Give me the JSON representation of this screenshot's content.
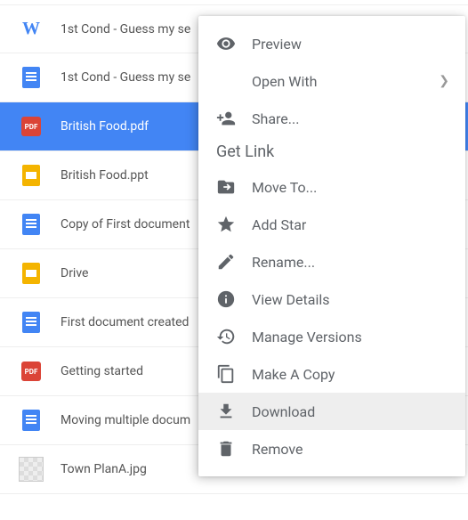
{
  "files": [
    {
      "name": "1st Cond - Guess my se",
      "icon": "word",
      "selected": false
    },
    {
      "name": "1st Cond - Guess my se",
      "icon": "docs",
      "selected": false
    },
    {
      "name": "British Food.pdf",
      "icon": "pdf",
      "selected": true
    },
    {
      "name": "British Food.ppt",
      "icon": "slides",
      "selected": false
    },
    {
      "name": "Copy of First document",
      "icon": "docs",
      "selected": false
    },
    {
      "name": "Drive",
      "icon": "slides",
      "selected": false
    },
    {
      "name": "First document created",
      "icon": "docs",
      "selected": false
    },
    {
      "name": "Getting started",
      "icon": "pdf",
      "selected": false
    },
    {
      "name": "Moving multiple docum",
      "icon": "docs",
      "selected": false
    },
    {
      "name": "Town PlanA.jpg",
      "icon": "image",
      "selected": false
    }
  ],
  "context_menu": {
    "section_label": "Get Link",
    "items": {
      "preview": "Preview",
      "open_with": "Open With",
      "share": "Share...",
      "move_to": "Move To...",
      "add_star": "Add Star",
      "rename": "Rename...",
      "view_details": "View Details",
      "manage_versions": "Manage Versions",
      "make_a_copy": "Make A Copy",
      "download": "Download",
      "remove": "Remove"
    }
  }
}
